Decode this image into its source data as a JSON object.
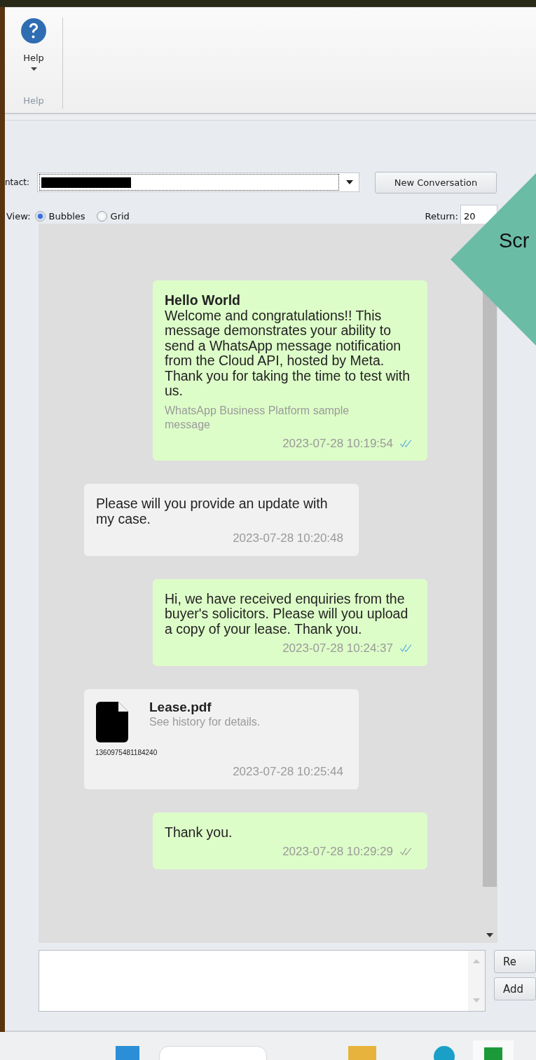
{
  "ribbon": {
    "groups": [
      {
        "caption": "Help",
        "buttons": [
          {
            "label": "Help",
            "has_menu": true
          }
        ]
      }
    ]
  },
  "contact": {
    "label": "ntact:",
    "redacted": true
  },
  "new_conversation_button": "New Conversation",
  "view": {
    "label": "View:",
    "options": [
      {
        "label": "Bubbles",
        "selected": true
      },
      {
        "label": "Grid",
        "selected": false
      }
    ]
  },
  "return": {
    "label": "Return:",
    "value": "20"
  },
  "messages": [
    {
      "outgoing": true,
      "kind": "text",
      "title": "Hello World",
      "body": "Welcome and congratulations!! This message demonstrates your ability to send a WhatsApp message notification from the Cloud API, hosted by Meta. Thank you for taking the time to test with us.",
      "footer": "WhatsApp Business Platform sample message",
      "time": "2023-07-28 10:19:54",
      "read": true
    },
    {
      "outgoing": false,
      "kind": "text",
      "body": "Please will you provide an update with my case.",
      "time": "2023-07-28 10:20:48"
    },
    {
      "outgoing": true,
      "kind": "text",
      "body": "Hi, we have received enquiries from the buyer's solicitors. Please will you upload a copy of your lease. Thank you.",
      "time": "2023-07-28 10:24:37",
      "read": true
    },
    {
      "outgoing": false,
      "kind": "file",
      "file_name": "Lease.pdf",
      "subtitle": "See history for details.",
      "file_id": "1360975481184240",
      "time": "2023-07-28 10:25:44"
    },
    {
      "outgoing": true,
      "kind": "text",
      "body": "Thank you.",
      "time": "2023-07-28 10:29:29",
      "read": false
    }
  ],
  "side_buttons": [
    "Re",
    "Add"
  ],
  "callout": {
    "text": "Scr"
  }
}
